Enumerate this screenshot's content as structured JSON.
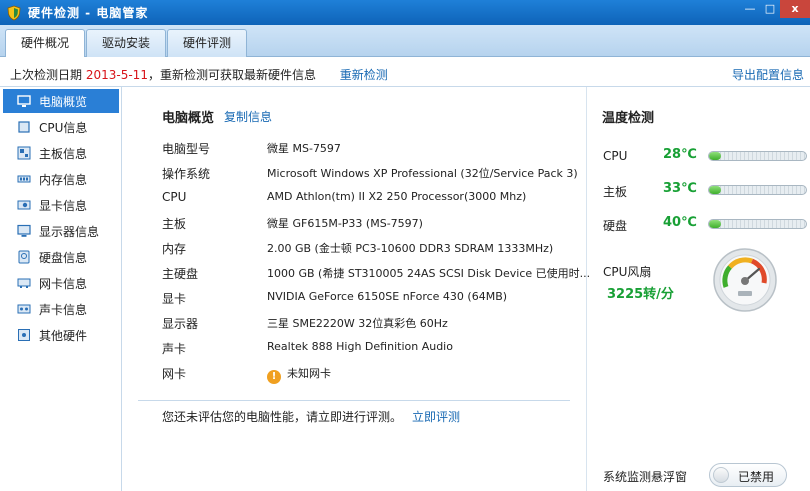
{
  "window": {
    "title": "硬件检测 - 电脑管家",
    "minimize": "—",
    "maximize": "□",
    "close": "x"
  },
  "tabs": [
    {
      "label": "硬件概况",
      "active": true
    },
    {
      "label": "驱动安装",
      "active": false
    },
    {
      "label": "硬件评测",
      "active": false
    }
  ],
  "infobar": {
    "prefix": "上次检测日期",
    "date": "2013-5-11",
    "suffix": "，重新检测可获取最新硬件信息",
    "recheck_link": "重新检测",
    "export_link": "导出配置信息"
  },
  "sidebar": {
    "items": [
      {
        "label": "电脑概览",
        "icon": "monitor-icon",
        "active": true
      },
      {
        "label": "CPU信息",
        "icon": "cpu-icon",
        "active": false
      },
      {
        "label": "主板信息",
        "icon": "motherboard-icon",
        "active": false
      },
      {
        "label": "内存信息",
        "icon": "memory-icon",
        "active": false
      },
      {
        "label": "显卡信息",
        "icon": "graphics-card-icon",
        "active": false
      },
      {
        "label": "显示器信息",
        "icon": "display-icon",
        "active": false
      },
      {
        "label": "硬盘信息",
        "icon": "hard-disk-icon",
        "active": false
      },
      {
        "label": "网卡信息",
        "icon": "network-card-icon",
        "active": false
      },
      {
        "label": "声卡信息",
        "icon": "sound-card-icon",
        "active": false
      },
      {
        "label": "其他硬件",
        "icon": "other-hardware-icon",
        "active": false
      }
    ]
  },
  "overview": {
    "title": "电脑概览",
    "copy_link": "复制信息",
    "rows": [
      {
        "key": "电脑型号",
        "value": "微星 MS-7597"
      },
      {
        "key": "操作系统",
        "value": "Microsoft Windows XP Professional (32位/Service Pack 3)"
      },
      {
        "key": "CPU",
        "value": "AMD Athlon(tm) II X2 250 Processor(3000 Mhz)"
      },
      {
        "key": "主板",
        "value": "微星 GF615M-P33  (MS-7597)"
      },
      {
        "key": "内存",
        "value": "2.00 GB (金士顿 PC3-10600 DDR3 SDRAM 1333MHz)"
      },
      {
        "key": "主硬盘",
        "value": "1000 GB (希捷 ST310005 24AS SCSI Disk Device 已使用时..."
      },
      {
        "key": "显卡",
        "value": "NVIDIA GeForce 6150SE nForce 430 (64MB)"
      },
      {
        "key": "显示器",
        "value": "三星 SME2220W 32位真彩色 60Hz"
      },
      {
        "key": "声卡",
        "value": "Realtek 888 High Definition Audio"
      },
      {
        "key": "网卡",
        "value": "未知网卡"
      }
    ],
    "eval_text": "您还未评估您的电脑性能，请立即进行评测。",
    "eval_link": "立即评测"
  },
  "temperature": {
    "title": "温度检测",
    "items": [
      {
        "label": "CPU",
        "value": "28℃",
        "level": 0.12
      },
      {
        "label": "主板",
        "value": "33℃",
        "level": 0.12
      },
      {
        "label": "硬盘",
        "value": "40℃",
        "level": 0.12
      }
    ],
    "fan_label": "CPU风扇",
    "fan_value": "3225转/分",
    "float_label": "系统监测悬浮窗",
    "float_state": "已禁用",
    "colors": {
      "temp_value": "#18a035",
      "bar_fill": "#3fae2d"
    }
  }
}
